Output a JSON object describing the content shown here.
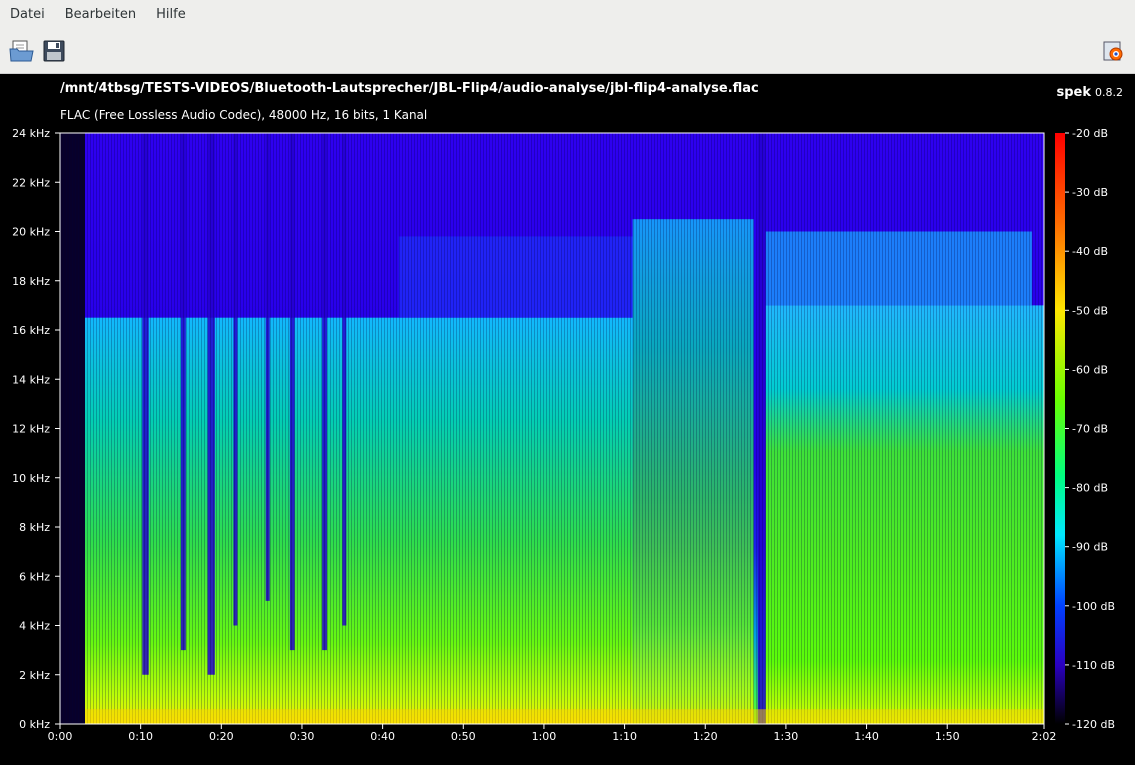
{
  "menubar": {
    "items": [
      {
        "label": "Datei"
      },
      {
        "label": "Bearbeiten"
      },
      {
        "label": "Hilfe"
      }
    ]
  },
  "toolbar": {
    "open_icon": "open-file-icon",
    "save_icon": "save-icon",
    "prefs_icon": "preferences-icon"
  },
  "header": {
    "file_path": "/mnt/4tbsg/TESTS-VIDEOS/Bluetooth-Lautsprecher/JBL-Flip4/audio-analyse/jbl-flip4-analyse.flac",
    "file_info": "FLAC (Free Lossless Audio Codec), 48000 Hz, 16 bits, 1 Kanal",
    "app_name": "spek",
    "app_version": "0.8.2"
  },
  "chart_data": {
    "type": "heatmap",
    "frequency_axis": {
      "unit": "kHz",
      "ticks": [
        "0 kHz",
        "2 kHz",
        "4 kHz",
        "6 kHz",
        "8 kHz",
        "10 kHz",
        "12 kHz",
        "14 kHz",
        "16 kHz",
        "18 kHz",
        "20 kHz",
        "22 kHz",
        "24 kHz"
      ],
      "range": [
        0,
        24
      ]
    },
    "time_axis": {
      "ticks": [
        "0:00",
        "0:10",
        "0:20",
        "0:30",
        "0:40",
        "0:50",
        "1:00",
        "1:10",
        "1:20",
        "1:30",
        "1:40",
        "1:50",
        "2:02"
      ],
      "duration_s": 122
    },
    "level_scale": {
      "unit": "dB",
      "ticks": [
        "-20 dB",
        "-30 dB",
        "-40 dB",
        "-50 dB",
        "-60 dB",
        "-70 dB",
        "-80 dB",
        "-90 dB",
        "-100 dB",
        "-110 dB",
        "-120 dB"
      ],
      "range": [
        -120,
        -20
      ]
    },
    "colors": {
      "background": "#2a00ff",
      "noise_floor": "#1400c8",
      "mid": "#00e0c0",
      "high": "#40ff00",
      "peak": "#ffff00"
    }
  }
}
